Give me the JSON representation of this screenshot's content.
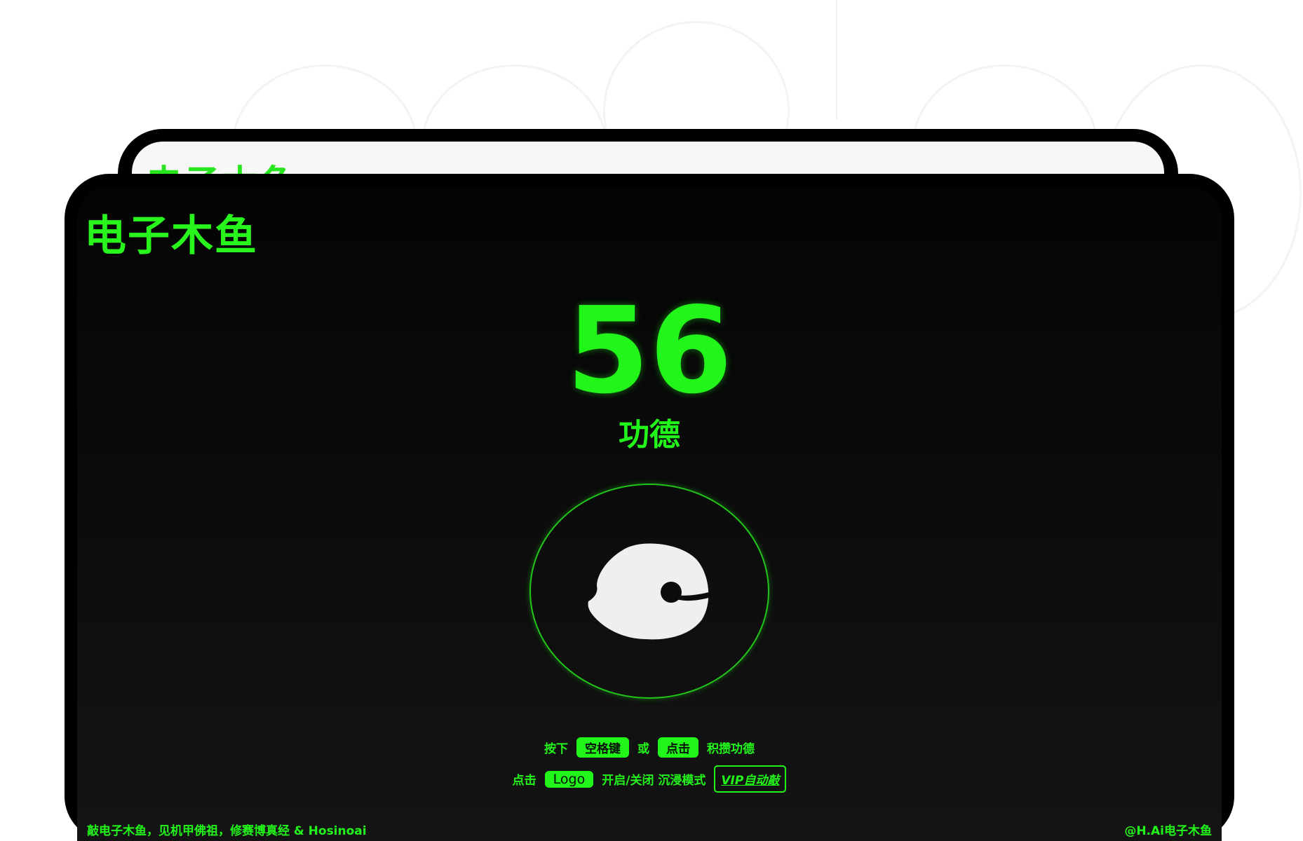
{
  "app": {
    "back_title": "电子木鱼",
    "title": "电子木鱼"
  },
  "counter": {
    "value": "56",
    "label": "功德"
  },
  "instructions": {
    "row1": {
      "press": "按下",
      "space_key": "空格键",
      "or": "或",
      "click_key": "点击",
      "accumulate": "积攒功德"
    },
    "row2": {
      "click": "点击",
      "logo_key": "Logo",
      "toggle_text": "开启/关闭 沉浸模式",
      "vip_button": "VIP自动敲"
    }
  },
  "footer": {
    "left": "敲电子木鱼，见机甲佛祖，修赛博真经 & Hosinoai",
    "right": "@H.Ai电子木鱼"
  },
  "colors": {
    "accent": "#22f51a",
    "background": "#0b0b0b",
    "fish": "#efefef"
  },
  "icons": {
    "wooden_fish": "wooden-fish-icon"
  }
}
